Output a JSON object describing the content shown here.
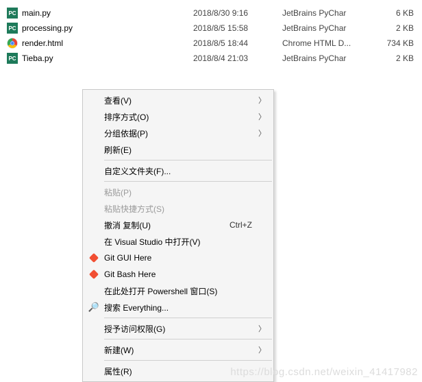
{
  "files": [
    {
      "name": "main.py",
      "date": "2018/8/30 9:16",
      "type": "JetBrains PyChar",
      "size": "6 KB",
      "icon": "pc"
    },
    {
      "name": "processing.py",
      "date": "2018/8/5 15:58",
      "type": "JetBrains PyChar",
      "size": "2 KB",
      "icon": "pc"
    },
    {
      "name": "render.html",
      "date": "2018/8/5 18:44",
      "type": "Chrome HTML D...",
      "size": "734 KB",
      "icon": "chrome"
    },
    {
      "name": "Tieba.py",
      "date": "2018/8/4 21:03",
      "type": "JetBrains PyChar",
      "size": "2 KB",
      "icon": "pc"
    }
  ],
  "menu": {
    "view": "查看(V)",
    "sort": "排序方式(O)",
    "group": "分组依据(P)",
    "refresh": "刷新(E)",
    "customize": "自定义文件夹(F)...",
    "paste": "粘贴(P)",
    "paste_shortcut": "粘贴快捷方式(S)",
    "undo_copy": "撤消 复制(U)",
    "undo_copy_key": "Ctrl+Z",
    "open_vs": "在 Visual Studio 中打开(V)",
    "git_gui": "Git GUI Here",
    "git_bash": "Git Bash Here",
    "open_ps": "在此处打开 Powershell 窗口(S)",
    "search_everything": "搜索 Everything...",
    "grant_access": "授予访问权限(G)",
    "new": "新建(W)",
    "properties": "属性(R)"
  },
  "watermark": "https://blog.csdn.net/weixin_41417982"
}
